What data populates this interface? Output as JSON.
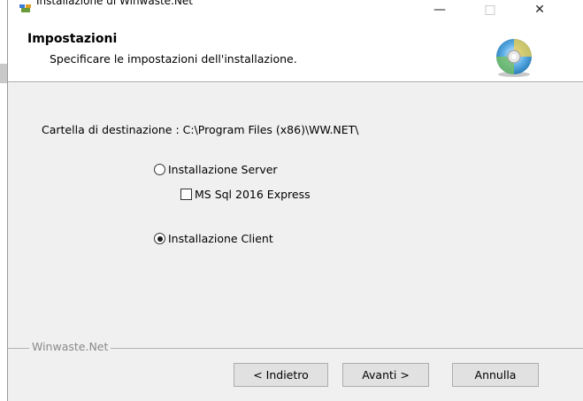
{
  "window": {
    "title": "Installazione di Winwaste.Net",
    "minimize": "—",
    "maximize": "□",
    "close": "✕"
  },
  "header": {
    "title": "Impostazioni",
    "subtitle": "Specificare le impostazioni dell'installazione."
  },
  "body": {
    "destination": "Cartella di destinazione : C:\\Program Files (x86)\\WW.NET\\",
    "options": {
      "server": {
        "label": "Installazione Server",
        "selected": false
      },
      "mssql": {
        "label": "MS Sql 2016 Express",
        "checked": false
      },
      "client": {
        "label": "Installazione Client",
        "selected": true
      }
    },
    "brand": "Winwaste.Net"
  },
  "buttons": {
    "back": "< Indietro",
    "next": "Avanti >",
    "cancel": "Annulla"
  }
}
